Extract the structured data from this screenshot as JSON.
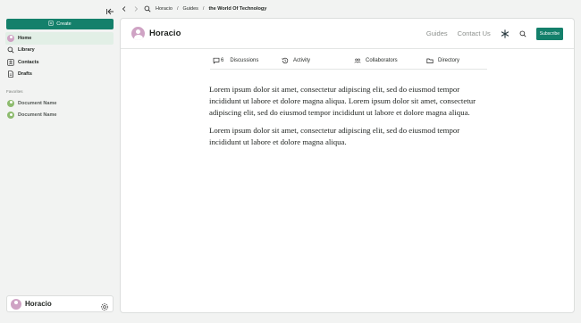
{
  "sidebar": {
    "create_label": "Create",
    "items": [
      {
        "label": "Home",
        "icon": "avatar",
        "active": true
      },
      {
        "label": "Library",
        "icon": "search-icon"
      },
      {
        "label": "Contacts",
        "icon": "contacts-icon"
      },
      {
        "label": "Drafts",
        "icon": "document-icon"
      }
    ],
    "favorites_title": "Favorites",
    "favorites": [
      {
        "label": "Document Name"
      },
      {
        "label": "Document Name"
      }
    ],
    "user": {
      "name": "Horacio"
    }
  },
  "breadcrumb": {
    "items": [
      "Horacio",
      "Guides"
    ],
    "current": "the World Of Technology",
    "separator": "/"
  },
  "header": {
    "brand": "Horacio",
    "nav": [
      "Guides",
      "Contact Us"
    ],
    "subscribe_label": "Subscribe"
  },
  "tabs": [
    {
      "label": "Discussions",
      "count": "6",
      "icon": "chat-icon"
    },
    {
      "label": "Activity",
      "icon": "history-icon"
    },
    {
      "label": "Collaborators",
      "icon": "people-icon"
    },
    {
      "label": "Directory",
      "icon": "folder-icon"
    }
  ],
  "article": {
    "paragraphs": [
      "Lorem ipsum dolor sit amet, consectetur adipiscing elit, sed do eiusmod tempor incididunt ut labore et dolore magna aliqua. Lorem ipsum dolor sit amet, consectetur adipiscing elit, sed do eiusmod tempor incididunt ut labore et dolore magna aliqua.",
      "Lorem ipsum dolor sit amet, consectetur adipiscing elit, sed do eiusmod tempor incididunt ut labore et dolore magna aliqua."
    ]
  },
  "colors": {
    "accent": "#14806b",
    "active_bg": "#e2efe6",
    "page_bg": "#f2f3f2"
  }
}
